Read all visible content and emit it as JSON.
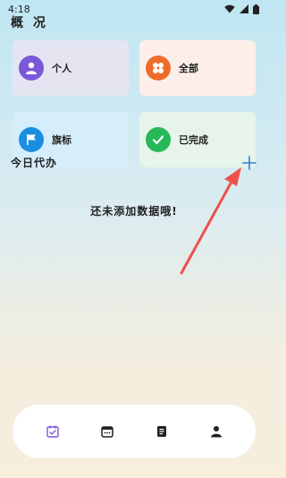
{
  "status_bar": {
    "time": "4:18",
    "icons": [
      "wifi-icon",
      "signal-icon",
      "battery-icon"
    ]
  },
  "header": {
    "title": "概 况"
  },
  "overview": {
    "cards": [
      {
        "label": "个人",
        "icon": "person-icon",
        "color": "#7b57d9"
      },
      {
        "label": "全部",
        "icon": "grid-icon",
        "color": "#ef6b2c"
      },
      {
        "label": "旗标",
        "icon": "flag-icon",
        "color": "#1a8fe0"
      },
      {
        "label": "已完成",
        "icon": "check-icon",
        "color": "#27b85a"
      }
    ]
  },
  "today": {
    "title": "今日代办",
    "add_icon": "plus-icon",
    "empty_text": "还未添加数据哦!"
  },
  "annotation": {
    "arrow_color": "#f0504b"
  },
  "bottom_nav": {
    "items": [
      {
        "icon": "calendar-check-icon",
        "active": true,
        "color": "#7b57d9"
      },
      {
        "icon": "calendar-icon",
        "active": false
      },
      {
        "icon": "notebook-icon",
        "active": false
      },
      {
        "icon": "person-icon",
        "active": false
      }
    ]
  }
}
